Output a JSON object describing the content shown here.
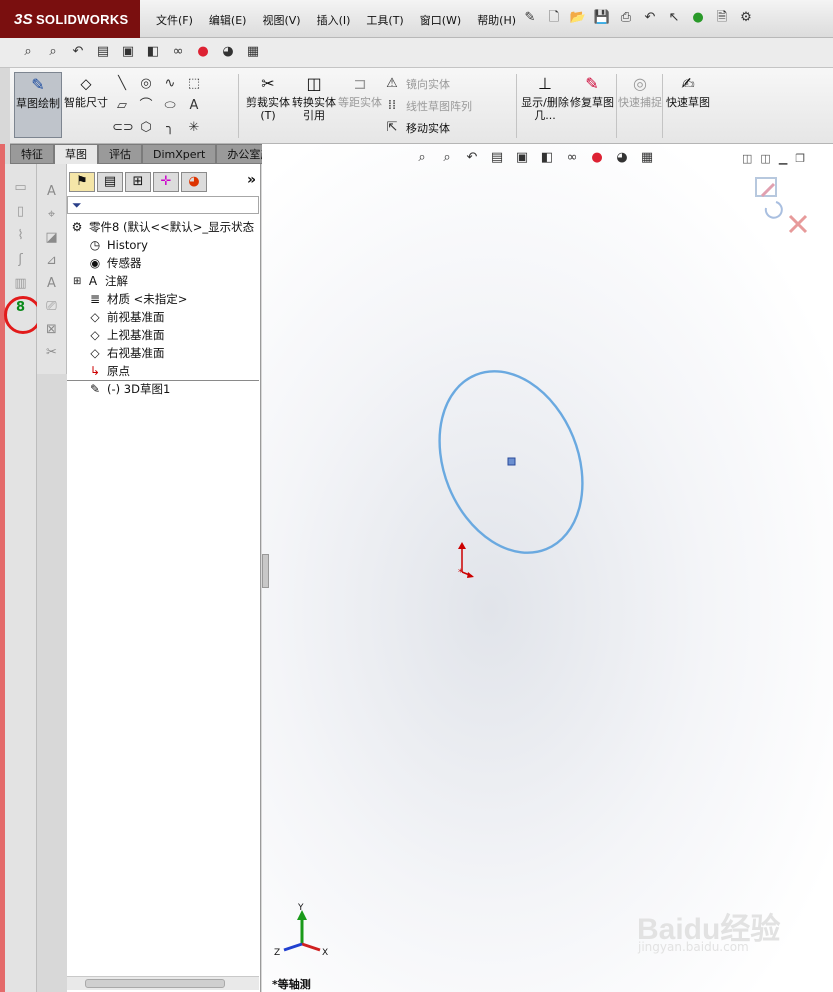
{
  "app": {
    "brand_prefix": "3S",
    "brand": "SOLIDWORKS"
  },
  "menu": [
    "文件(F)",
    "编辑(E)",
    "视图(V)",
    "插入(I)",
    "工具(T)",
    "窗口(W)",
    "帮助(H)"
  ],
  "command": {
    "sketch": "草图绘制",
    "smart_dim": "智能尺寸",
    "trim": "剪裁实体(T)",
    "convert": "转换实体引用",
    "offset": "等距实体",
    "mirror": "镜向实体",
    "linear_pattern": "线性草图阵列",
    "move": "移动实体",
    "display_delete": "显示/删除几...",
    "repair": "修复草图",
    "quick_snap": "快速捕捉",
    "quick_sketch": "快速草图"
  },
  "tabs": [
    {
      "label": "特征"
    },
    {
      "label": "草图"
    },
    {
      "label": "评估"
    },
    {
      "label": "DimXpert"
    },
    {
      "label": "办公室产品"
    }
  ],
  "tree": {
    "root": "零件8 (默认<<默认>_显示状态",
    "items": [
      {
        "label": "History"
      },
      {
        "label": "传感器"
      },
      {
        "label": "注解"
      },
      {
        "label": "材质 <未指定>"
      },
      {
        "label": "前视基准面"
      },
      {
        "label": "上视基准面"
      },
      {
        "label": "右视基准面"
      },
      {
        "label": "原点"
      },
      {
        "label": "(-) 3D草图1"
      }
    ]
  },
  "graphics": {
    "view_label": "*等轴测",
    "axis_x": "X",
    "axis_y": "Y",
    "axis_z": "Z",
    "watermark": "Baidu经验",
    "watermark_url": "jingyan.baidu.com",
    "ellipse_color": "#6aa9e0"
  },
  "panel_more": "»"
}
